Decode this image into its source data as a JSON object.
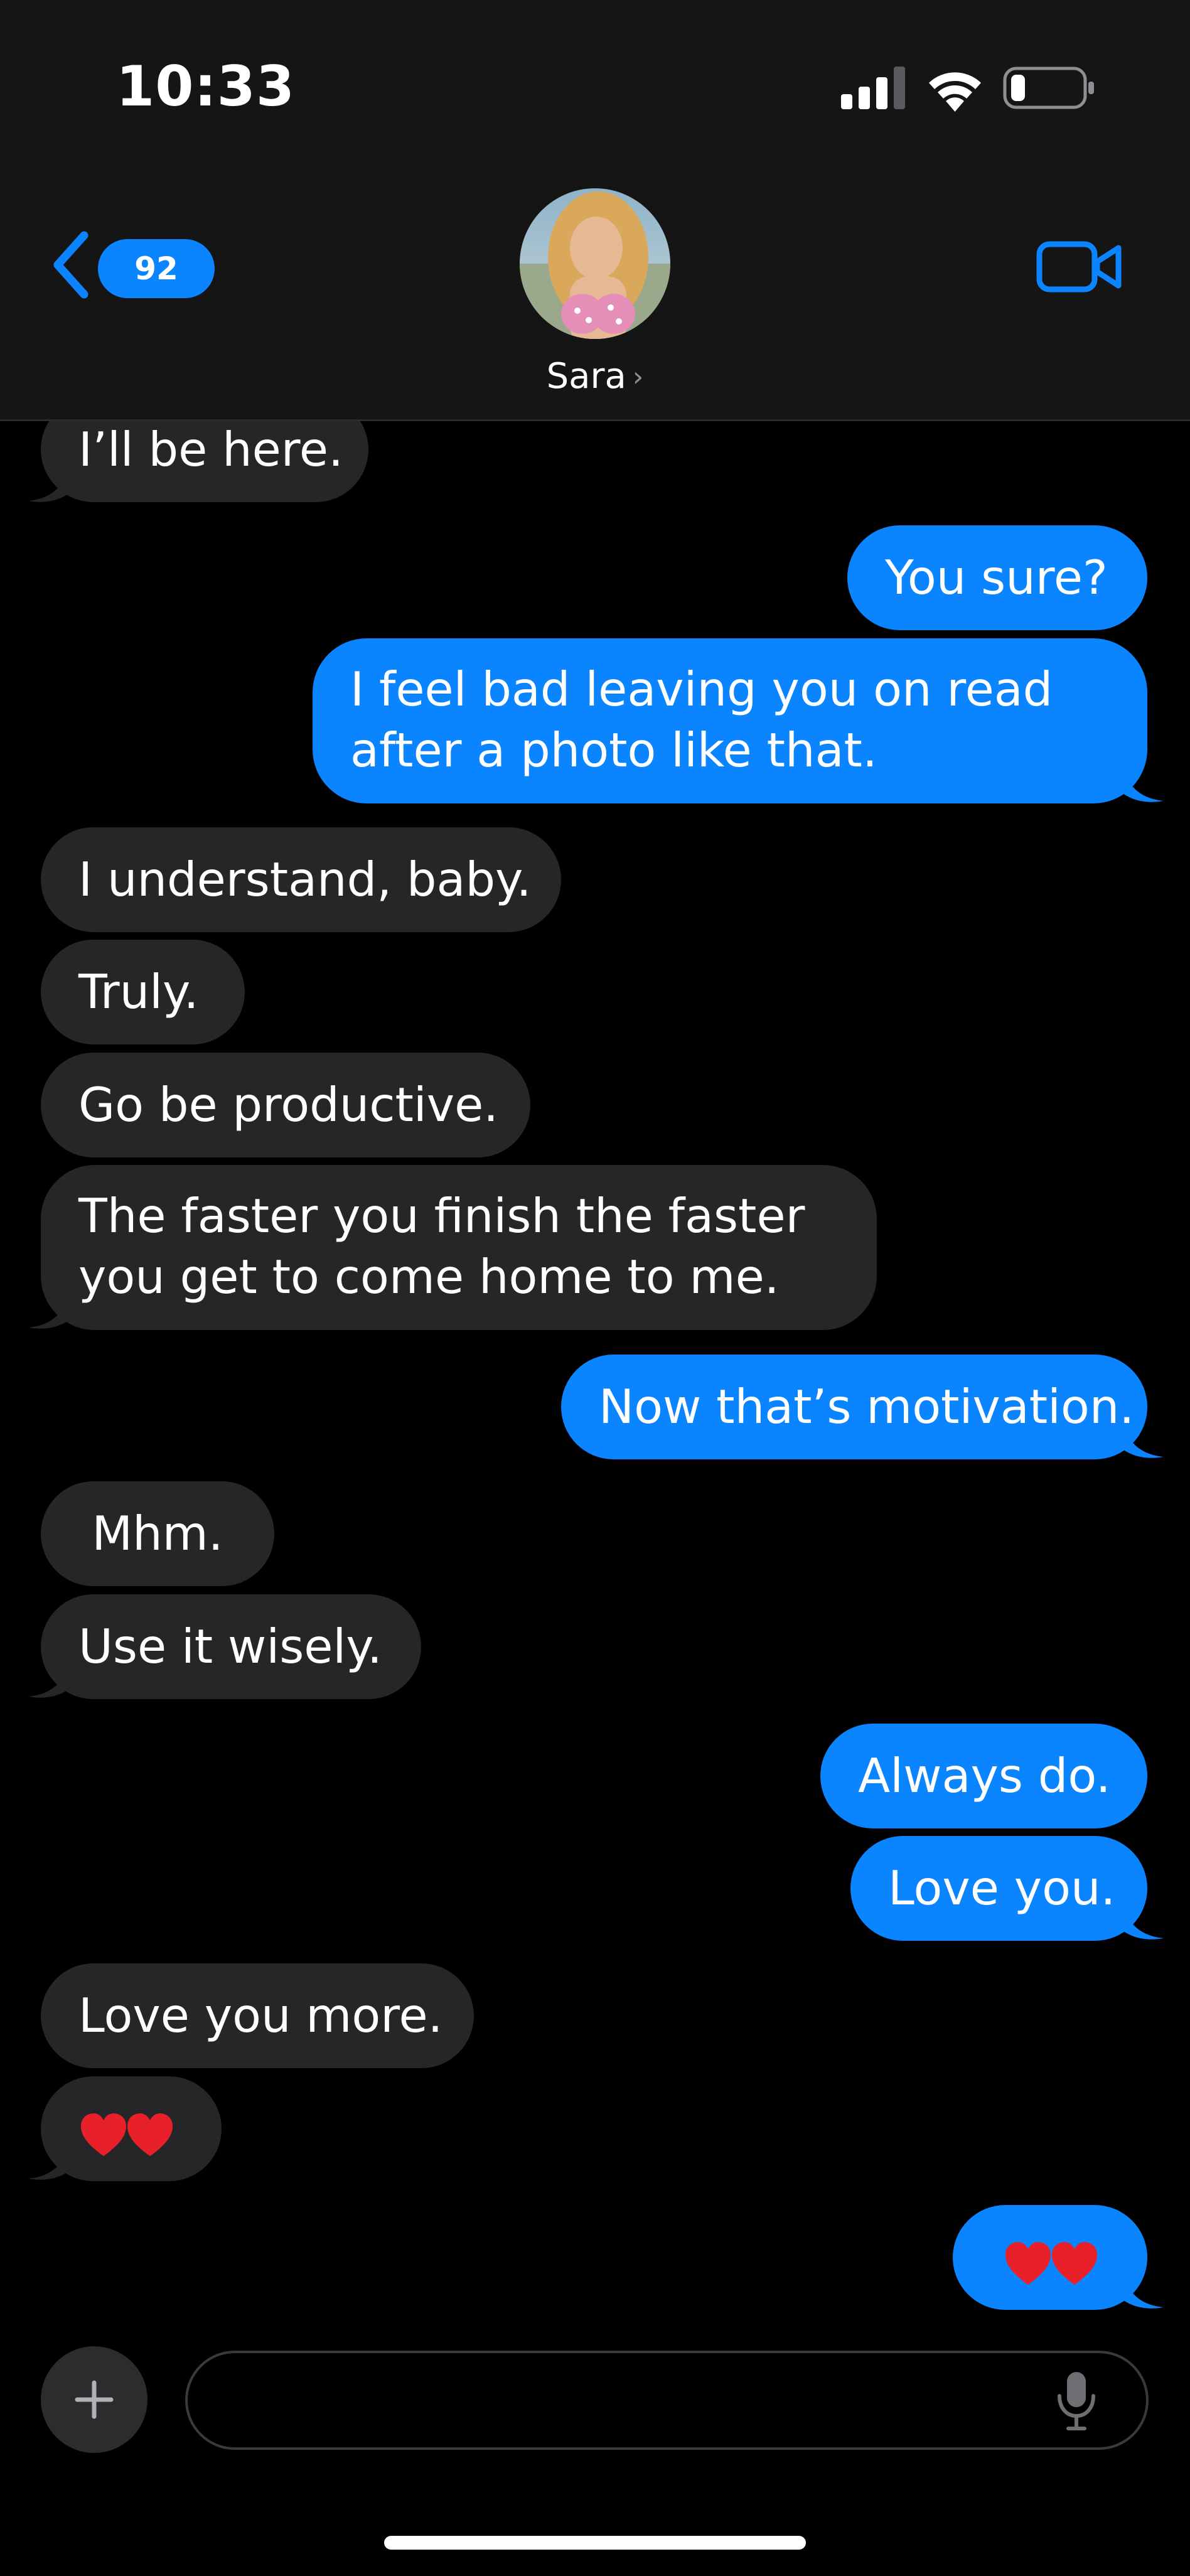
{
  "status_bar": {
    "time": "10:33",
    "icons": [
      "cellular-signal-icon",
      "wifi-icon",
      "battery-icon"
    ]
  },
  "header": {
    "back_badge_count": "92",
    "contact_name": "Sara",
    "contact_chevron": "›",
    "icons": [
      "back-chevron-icon",
      "contact-avatar",
      "video-camera-icon"
    ]
  },
  "messages": [
    {
      "from": "them",
      "text": "I’ll be here."
    },
    {
      "from": "me",
      "text": "You sure?"
    },
    {
      "from": "me",
      "lines": [
        "I feel bad leaving you on read",
        "after a photo like that."
      ]
    },
    {
      "from": "them",
      "text": "I understand, baby."
    },
    {
      "from": "them",
      "text": "Truly."
    },
    {
      "from": "them",
      "text": "Go be productive."
    },
    {
      "from": "them",
      "lines": [
        "The faster you finish the faster",
        "you get to come home to me."
      ]
    },
    {
      "from": "me",
      "text": "Now that’s motivation."
    },
    {
      "from": "them",
      "text": "Mhm."
    },
    {
      "from": "them",
      "text": "Use it wisely."
    },
    {
      "from": "me",
      "text": "Always do."
    },
    {
      "from": "me",
      "text": "Love you."
    },
    {
      "from": "them",
      "text": "Love you more."
    },
    {
      "from": "them",
      "emoji": [
        "red-heart",
        "red-heart"
      ]
    },
    {
      "from": "me",
      "emoji": [
        "red-heart",
        "red-heart"
      ]
    }
  ],
  "composer": {
    "input_value": "",
    "placeholder": "",
    "icons": [
      "plus-icon",
      "microphone-icon"
    ]
  },
  "colors": {
    "background": "#000000",
    "header_background": "#151515",
    "incoming_bubble": "#262628",
    "outgoing_bubble": "#0a84ff",
    "accent": "#0a84ff",
    "heart": "#e8202a"
  }
}
